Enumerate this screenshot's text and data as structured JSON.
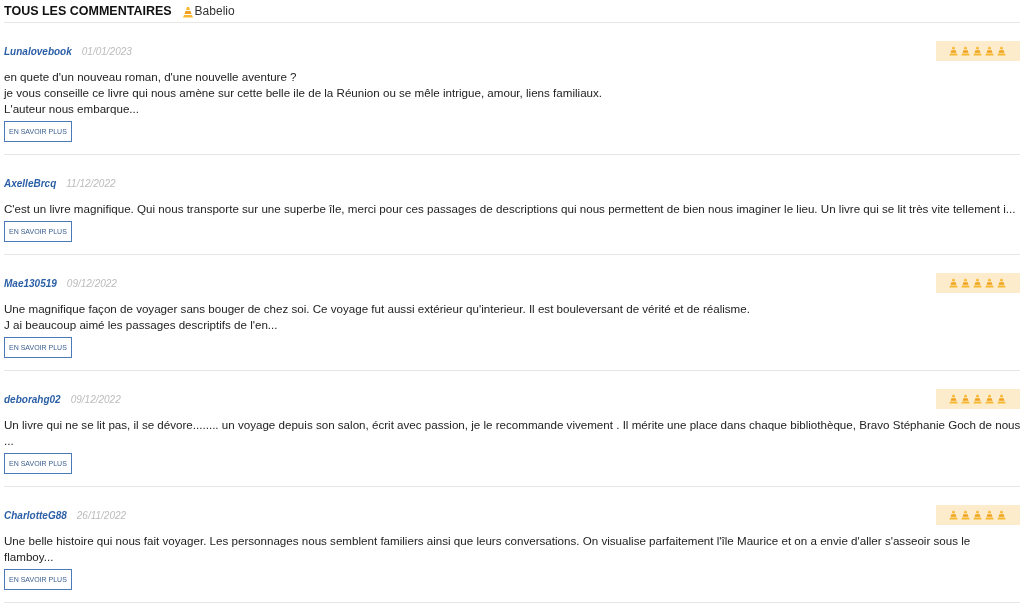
{
  "header": {
    "title": "TOUS LES COMMENTAIRES",
    "source": "Babelio"
  },
  "reviews": [
    {
      "author": "Lunalovebook",
      "date": "01/01/2023",
      "stars": 5,
      "lines": [
        "en quete d'un nouveau roman, d'une nouvelle aventure ?",
        "je vous conseille ce livre qui nous amène sur cette belle ile de la Réunion ou se mêle intrigue, amour, liens familiaux.",
        "L'auteur nous embarque..."
      ],
      "button": "EN SAVOIR PLUS"
    },
    {
      "author": "AxelleBrcq",
      "date": "11/12/2022",
      "stars": 0,
      "lines": [
        "C'est un livre magnifique. Qui nous transporte sur une superbe île, merci pour ces passages de descriptions qui nous permettent de bien nous imaginer le lieu. Un livre qui se lit très vite tellement i..."
      ],
      "button": "EN SAVOIR PLUS"
    },
    {
      "author": "Mae130519",
      "date": "09/12/2022",
      "stars": 5,
      "lines": [
        "Une magnifique façon de voyager sans bouger de chez soi. Ce voyage fut aussi extérieur qu'interieur. Il est bouleversant de vérité et de réalisme.",
        "J ai beaucoup aimé les passages descriptifs de l'en..."
      ],
      "button": "EN SAVOIR PLUS"
    },
    {
      "author": "deborahg02",
      "date": "09/12/2022",
      "stars": 5,
      "lines": [
        "Un livre qui ne se lit pas, il se dévore........ un voyage depuis son salon, écrit avec passion, je le recommande vivement . Il mérite une place dans chaque bibliothèque, Bravo Stéphanie Goch de nous",
        "..."
      ],
      "button": "EN SAVOIR PLUS"
    },
    {
      "author": "CharlotteG88",
      "date": "26/11/2022",
      "stars": 5,
      "lines": [
        "Une belle histoire qui nous fait voyager. Les personnages nous semblent familiers ainsi que leurs conversations. On visualise parfaitement l'île Maurice et on a envie d'aller s'asseoir sous le",
        "flamboy..."
      ],
      "button": "EN SAVOIR PLUS"
    }
  ]
}
